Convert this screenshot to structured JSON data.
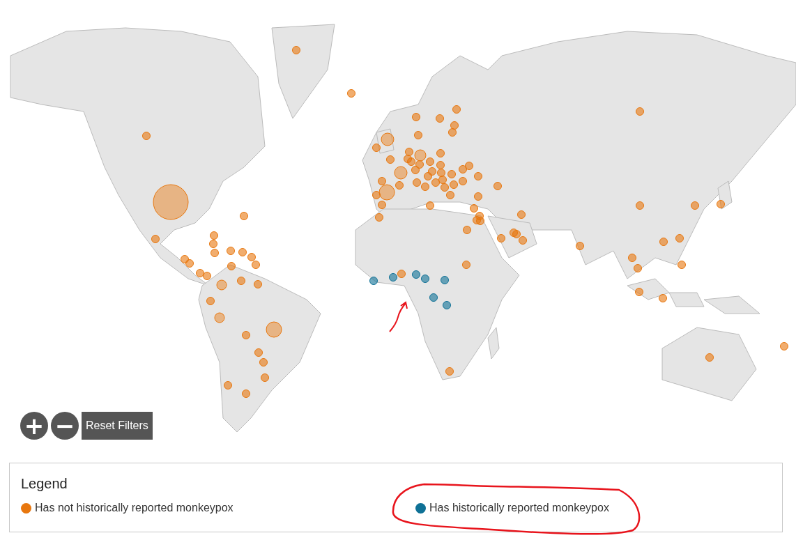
{
  "map_controls": {
    "zoom_in": "+",
    "zoom_out": "−",
    "reset": "Reset Filters"
  },
  "legend": {
    "title": "Legend",
    "items": [
      {
        "label": "Has not historically reported monkeypox",
        "color": "#e8770e"
      },
      {
        "label": "Has historically reported monkeypox",
        "color": "#0f7196"
      }
    ]
  }
}
